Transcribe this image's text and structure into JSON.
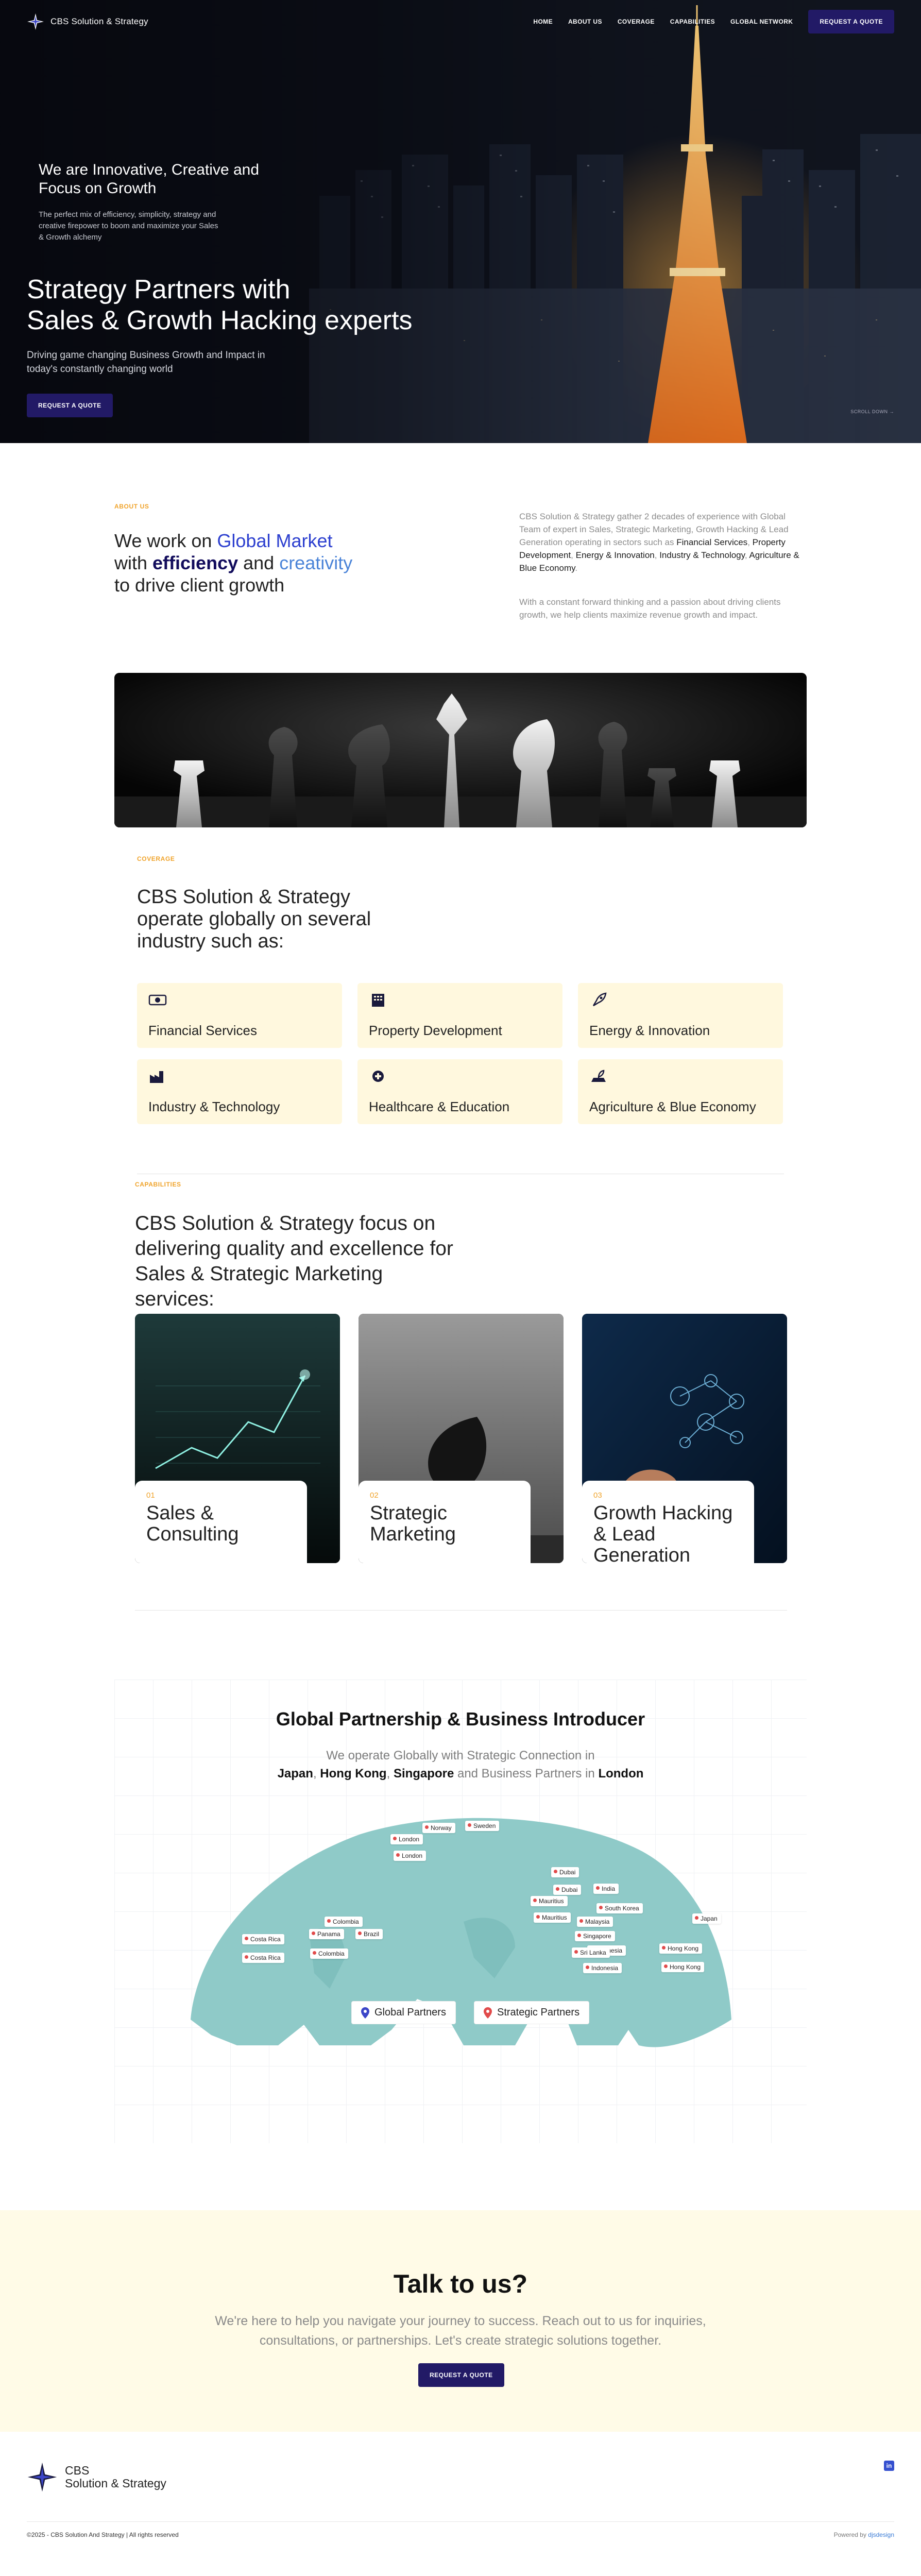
{
  "nav": {
    "brand": "CBS Solution & Strategy",
    "links": [
      "HOME",
      "ABOUT US",
      "COVERAGE",
      "CAPABILITIES",
      "GLOBAL NETWORK"
    ],
    "cta": "REQUEST A QUOTE"
  },
  "hero": {
    "kicker": "We are Innovative, Creative and Focus on Growth",
    "kicker_sub": "The perfect mix of efficiency, simplicity, strategy and creative firepower to boom and maximize your Sales & Growth alchemy",
    "headline_line1": "Strategy Partners with",
    "headline_line2": "Sales & Growth Hacking experts",
    "paragraph": "Driving game changing Business Growth and Impact in today's constantly changing world",
    "cta": "REQUEST A QUOTE",
    "scroll_label": "SCROLL DOWN"
  },
  "about": {
    "label": "ABOUT US",
    "h_part1": "We work on ",
    "h_part2": "Global Market",
    "h_part3": " with ",
    "h_part4": "efficiency",
    "h_part5": " and ",
    "h_part6": "creativity",
    "h_part7": " to drive client growth",
    "p1_a": "CBS Solution & Strategy gather 2 decades of experience with Global Team of expert in Sales, Strategic Marketing, Growth Hacking & Lead Generation operating in sectors such as ",
    "p1_b": "Financial Services",
    "p1_c": ", ",
    "p1_d": "Property Development",
    "p1_e": ", ",
    "p1_f": "Energy & Innovation",
    "p1_g": ", ",
    "p1_h": "Industry & Technology",
    "p1_i": ", ",
    "p1_j": "Agriculture & Blue Economy",
    "p1_k": ".",
    "p2": "With a constant forward thinking and a passion about driving clients growth, we help clients maximize revenue growth and impact."
  },
  "coverage": {
    "label": "COVERAGE",
    "heading": "CBS Solution & Strategy operate globally on several industry such as:",
    "industries": [
      {
        "label": "Financial Services",
        "icon": "money-icon"
      },
      {
        "label": "Property Development",
        "icon": "building-icon"
      },
      {
        "label": "Energy & Innovation",
        "icon": "rocket-icon"
      },
      {
        "label": "Industry & Technology",
        "icon": "factory-icon"
      },
      {
        "label": "Healthcare & Education",
        "icon": "healthcare-icon"
      },
      {
        "label": "Agriculture & Blue Economy",
        "icon": "agriculture-icon"
      }
    ]
  },
  "capabilities": {
    "label": "CAPABILITIES",
    "heading": "CBS Solution & Strategy focus on delivering quality and excellence for Sales & Strategic Marketing services:",
    "cards": [
      {
        "num": "01",
        "title": "Sales & Consulting"
      },
      {
        "num": "02",
        "title": "Strategic Marketing"
      },
      {
        "num": "03",
        "title": "Growth Hacking & Lead Generation"
      }
    ]
  },
  "global": {
    "heading": "Global Partnership & Business Introducer",
    "p_line1": "We operate Globally with Strategic Connection in",
    "p_japan": "Japan",
    "p_c1": ", ",
    "p_hk": "Hong Kong",
    "p_c2": ", ",
    "p_sg": "Singapore",
    "p_mid": " and Business Partners in ",
    "p_london": "London",
    "pins": [
      "Norway",
      "Sweden",
      "London",
      "London",
      "Dubai",
      "India",
      "Dubai",
      "South Korea",
      "Mauritius",
      "Japan",
      "Mauritius",
      "Malaysia",
      "Singapore",
      "Indonesia",
      "Hong Kong",
      "Sri Lanka",
      "Indonesia",
      "Hong Kong",
      "Colombia",
      "Costa Rica",
      "Panama",
      "Brazil",
      "Costa Rica",
      "Colombia"
    ],
    "legend_global": "Global Partners",
    "legend_strategic": "Strategic Partners"
  },
  "talk": {
    "heading": "Talk to us?",
    "paragraph_line1": "We're here to help you navigate your journey to success. Reach out to us for inquiries,",
    "paragraph_line2": "consultations, or partnerships. Let's create strategic solutions together.",
    "cta": "REQUEST A QUOTE"
  },
  "footer": {
    "brand_line1": "CBS",
    "brand_line2": "Solution & Strategy",
    "copyright": "©2025 - CBS Solution And Strategy | All rights reserved",
    "powered_prefix": "Powered by ",
    "powered_by": "djsdesign"
  }
}
